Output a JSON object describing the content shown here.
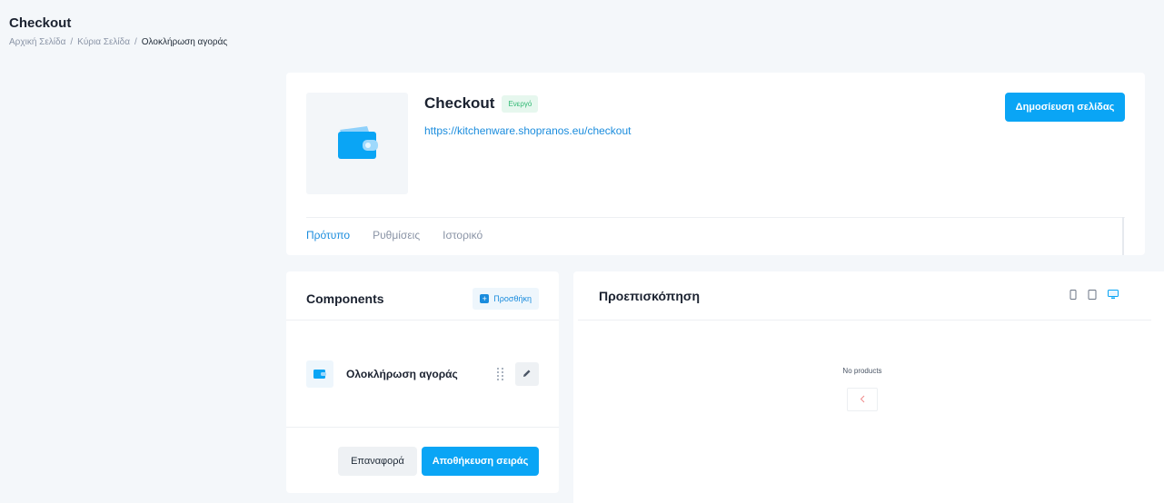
{
  "header": {
    "title": "Checkout",
    "breadcrumb": [
      "Αρχική Σελίδα",
      "Κύρια Σελίδα",
      "Ολοκλήρωση αγοράς"
    ],
    "separator": "/"
  },
  "page": {
    "name": "Checkout",
    "status": "Ενεργό",
    "url": "https://kitchenware.shopranos.eu/checkout",
    "publish_label": "Δημοσίευση σελίδας",
    "thumb_icon": "wallet-icon"
  },
  "tabs": [
    {
      "label": "Πρότυπο",
      "active": true
    },
    {
      "label": "Ρυθμίσεις",
      "active": false
    },
    {
      "label": "Ιστορικό",
      "active": false
    }
  ],
  "components": {
    "title": "Components",
    "add_label": "Προσθήκη",
    "items": [
      {
        "label": "Ολοκλήρωση αγοράς",
        "icon": "wallet-icon"
      }
    ],
    "reset_label": "Επαναφορά",
    "save_label": "Αποθήκευση σειράς"
  },
  "preview": {
    "title": "Προεπισκόπηση",
    "devices": [
      "mobile-icon",
      "tablet-icon",
      "desktop-icon"
    ],
    "active_device": "desktop-icon",
    "empty_text": "No products"
  },
  "colors": {
    "accent": "#0aa5f5",
    "link": "#1a8cdd",
    "status_green": "#2eb872",
    "background": "#f4f7fa"
  }
}
